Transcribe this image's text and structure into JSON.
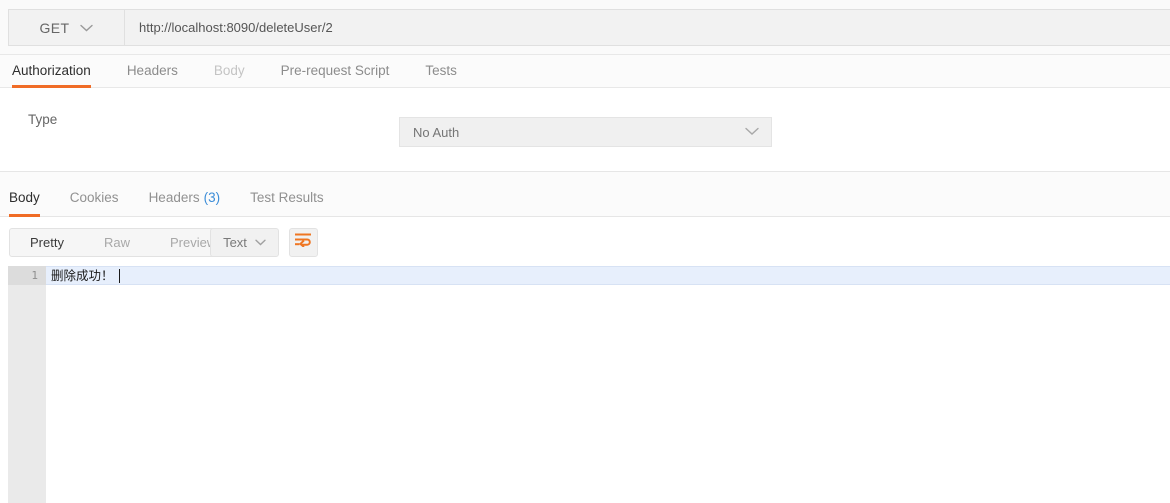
{
  "request_bar": {
    "method": "GET",
    "method_caret_icon": "chevron-down-icon",
    "url": "http://localhost:8090/deleteUser/2"
  },
  "request_tabs": [
    {
      "label": "Authorization",
      "state": "active"
    },
    {
      "label": "Headers",
      "state": "normal"
    },
    {
      "label": "Body",
      "state": "disabled"
    },
    {
      "label": "Pre-request Script",
      "state": "normal"
    },
    {
      "label": "Tests",
      "state": "normal"
    }
  ],
  "auth_pane": {
    "type_label": "Type",
    "type_value": "No Auth",
    "caret_icon": "chevron-down-icon"
  },
  "response_tabs": [
    {
      "label": "Body",
      "count": "",
      "state": "active"
    },
    {
      "label": "Cookies",
      "count": "",
      "state": "normal"
    },
    {
      "label": "Headers",
      "count": "(3)",
      "state": "normal"
    },
    {
      "label": "Test Results",
      "count": "",
      "state": "normal"
    }
  ],
  "body_toolbar": {
    "view_modes": [
      {
        "label": "Pretty",
        "state": "active"
      },
      {
        "label": "Raw",
        "state": "normal"
      },
      {
        "label": "Preview",
        "state": "normal"
      }
    ],
    "format": "Text",
    "format_caret_icon": "chevron-down-icon",
    "wrap_button_icon": "word-wrap-icon"
  },
  "response_body": {
    "lines": [
      {
        "number": "1",
        "text": "删除成功！"
      }
    ]
  },
  "colors": {
    "accent_orange": "#f06c26",
    "link_blue": "#3c8dd8",
    "active_line_blue": "#e7effc",
    "gutter_gray": "#eaeaea"
  }
}
